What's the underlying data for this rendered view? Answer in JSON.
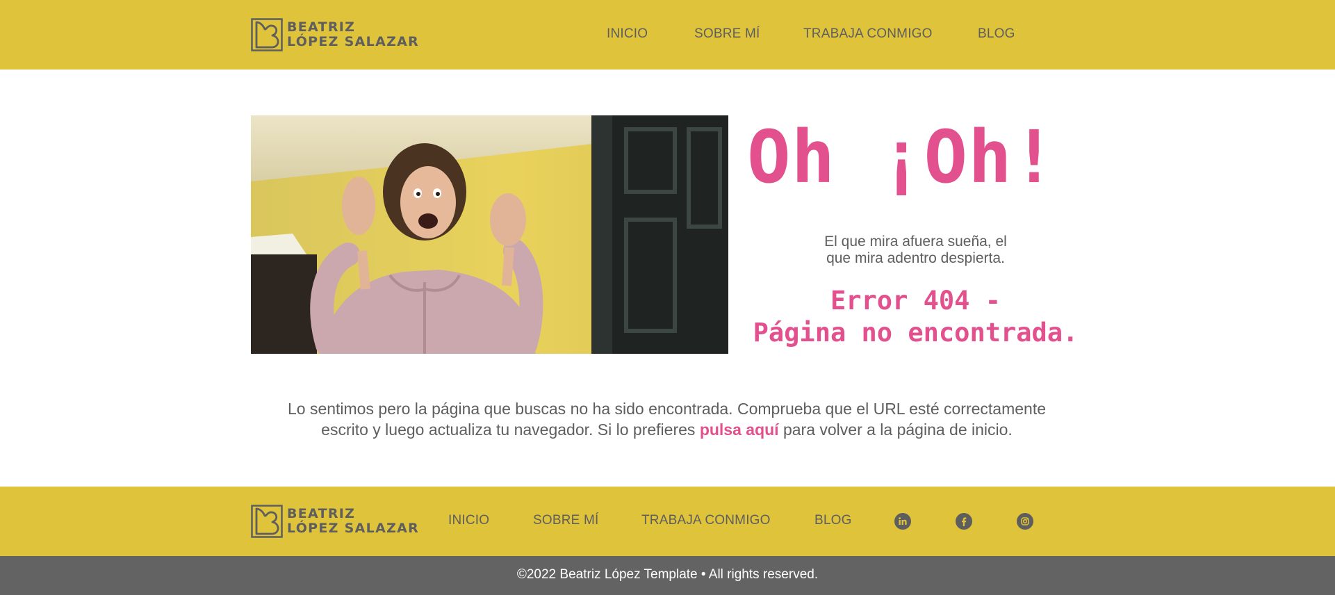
{
  "colors": {
    "brand_yellow": "#dfc33b",
    "accent_pink": "#e2508e",
    "text_gray": "#5e5e5e",
    "copyright_bar": "#636363"
  },
  "brand": {
    "line1": "BEATRIZ",
    "line2": "LÓPEZ SALAZAR"
  },
  "header_nav": [
    "INICIO",
    "SOBRE MÍ",
    "TRABAJA CONMIGO",
    "BLOG"
  ],
  "main": {
    "headline": "Oh ¡Oh!",
    "quote_line1": "El que mira afuera sueña, el",
    "quote_line2": "que mira adentro despierta.",
    "error_line1": "Error 404 -",
    "error_line2": "Página no encontrada.",
    "message_line1": "Lo sentimos pero la página que buscas no ha sido encontrada. Comprueba que el URL esté correctamente",
    "message_line2_before": "escrito y luego actualiza tu navegador. Si lo prefieres ",
    "message_link": "pulsa aquí",
    "message_line2_after": " para volver a la página de inicio."
  },
  "footer_nav": [
    "INICIO",
    "SOBRE MÍ",
    "TRABAJA CONMIGO",
    "BLOG"
  ],
  "social_icons": [
    "linkedin-icon",
    "facebook-icon",
    "instagram-icon"
  ],
  "copyright": "©2022 Beatriz López Template • All rights reserved."
}
